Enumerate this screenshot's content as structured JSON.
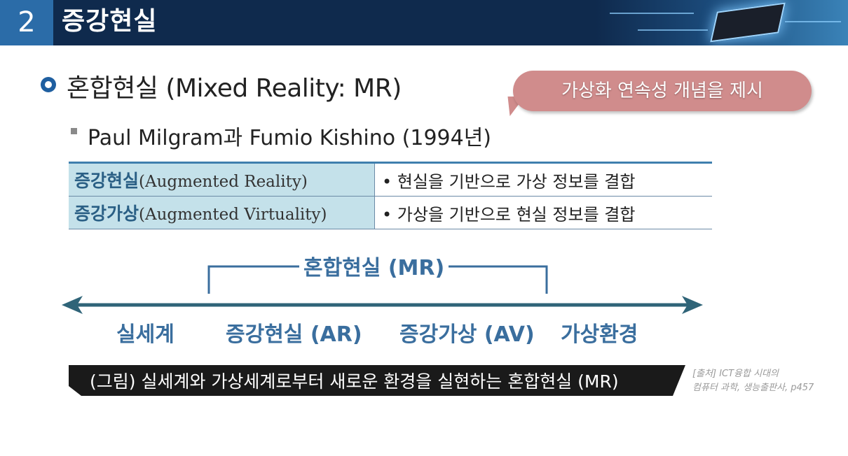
{
  "header": {
    "number": "2",
    "title": "증강현실"
  },
  "heading": {
    "text": "혼합현실 (Mixed Reality: MR)",
    "callout": "가상화 연속성 개념을 제시"
  },
  "sub_heading": "Paul Milgram과 Fumio Kishino (1994년)",
  "table": {
    "rows": [
      {
        "term_ko": "증강현실",
        "term_en": "(Augmented Reality)",
        "desc": "• 현실을 기반으로 가상 정보를 결합"
      },
      {
        "term_ko": "증강가상",
        "term_en": "(Augmented Virtuality)",
        "desc": "• 가상을 기반으로 현실 정보를 결합"
      }
    ]
  },
  "diagram": {
    "mr_label": "혼합현실 (MR)",
    "labels": [
      "실세계",
      "증강현실 (AR)",
      "증강가상 (AV)",
      "가상환경"
    ]
  },
  "caption": "(그림) 실세계와 가상세계로부터 새로운 환경을 실현하는 혼합현실 (MR)",
  "source": {
    "line1": "[출처] ICT융합 시대의",
    "line2": "컴퓨터 과학, 생능출판사, p457"
  },
  "colors": {
    "header_bg": "#0f2a4d",
    "number_bg": "#2b6ca8",
    "accent_blue": "#3a6e9e",
    "callout_bg": "#d08c8c",
    "table_term_bg": "#c4e1ea",
    "arrow": "#2f6478"
  }
}
